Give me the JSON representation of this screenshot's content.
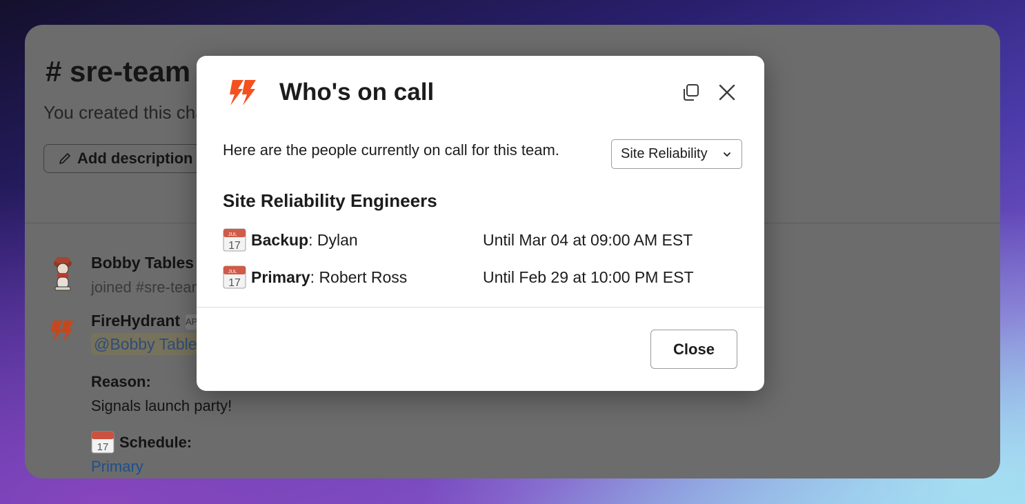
{
  "background": {
    "accent": "#4a3aa8"
  },
  "channel": {
    "title": "# sre-team",
    "created_text": "You created this channel",
    "add_description_label": "Add description"
  },
  "messages": [
    {
      "sender": "Bobby Tables",
      "text": "joined #sre-team."
    },
    {
      "sender": "FireHydrant",
      "badge": "APP",
      "mention": "@Bobby Tables",
      "reason_label": "Reason:",
      "reason": "Signals launch party!",
      "schedule_label": "Schedule:",
      "schedule_link": "Primary"
    }
  ],
  "modal": {
    "title": "Who's on call",
    "intro": "Here are the people currently on call for this team.",
    "team_select": {
      "selected": "Site Reliability"
    },
    "section_title": "Site Reliability Engineers",
    "rows": [
      {
        "role": "Backup",
        "person": ": Dylan",
        "until": "Until Mar 04 at 09:00 AM EST"
      },
      {
        "role": "Primary",
        "person": ": Robert Ross",
        "until": "Until Feb 29 at 10:00 PM EST"
      }
    ],
    "calendar_icon": {
      "month": "JUL",
      "day": "17"
    },
    "close_label": "Close",
    "brand_color": "#f4511e"
  }
}
